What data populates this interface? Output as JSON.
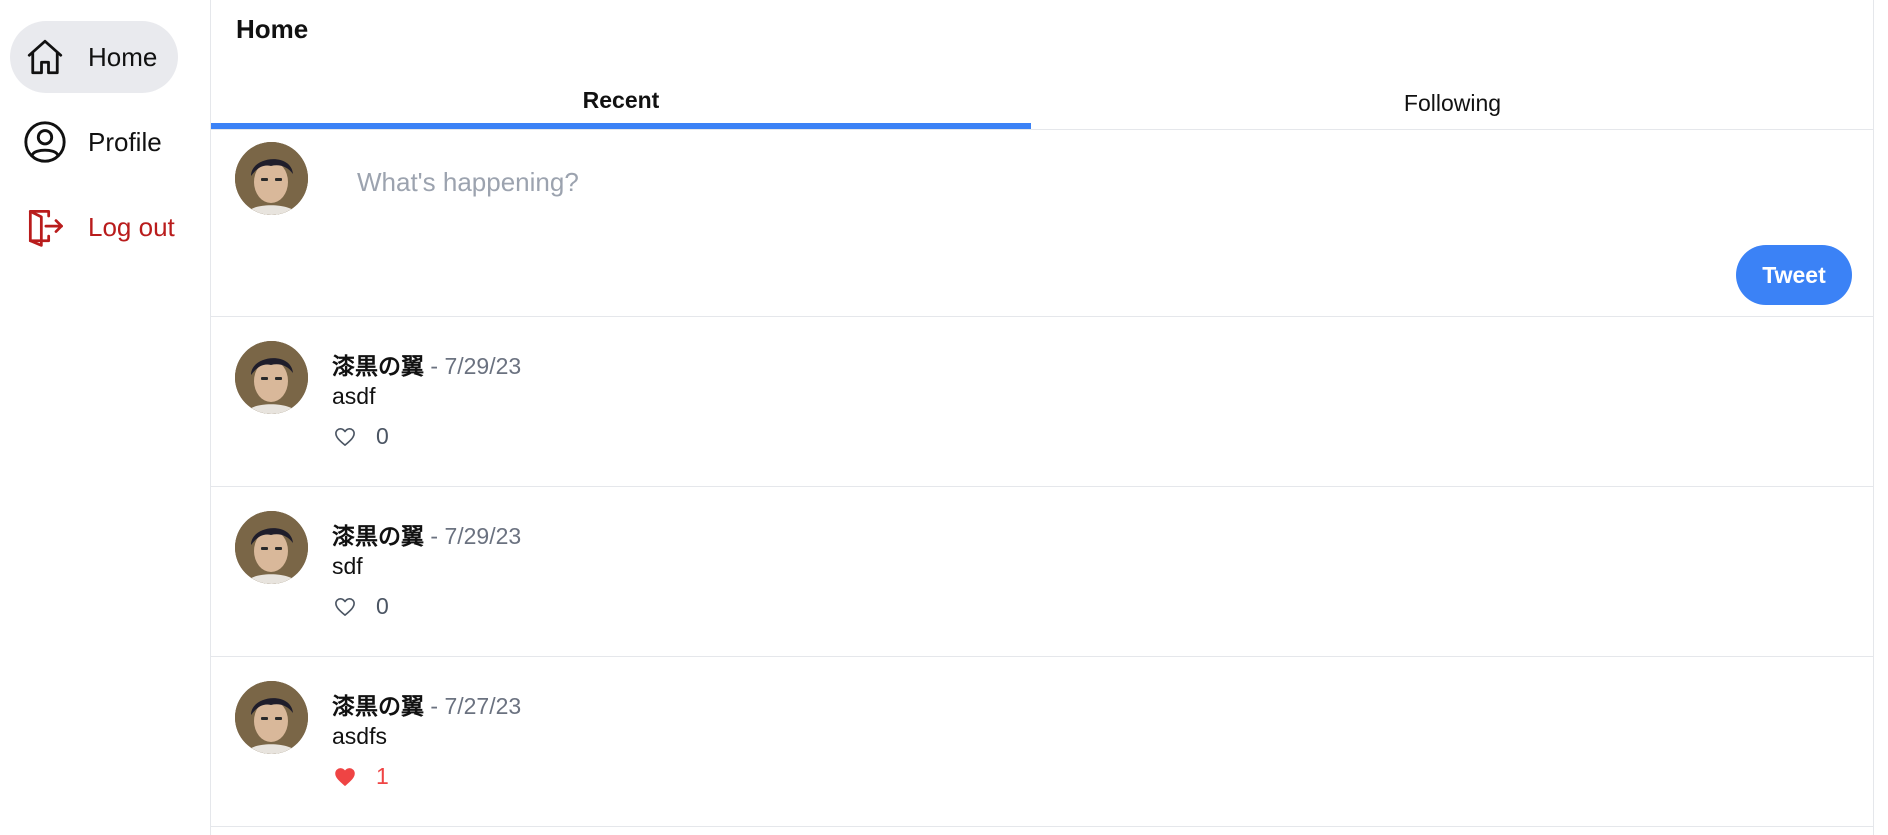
{
  "sidebar": {
    "items": [
      {
        "label": "Home",
        "icon": "home-icon"
      },
      {
        "label": "Profile",
        "icon": "user-circle-icon"
      },
      {
        "label": "Log out",
        "icon": "logout-icon",
        "color": "#b91c1c"
      }
    ]
  },
  "header": {
    "title": "Home"
  },
  "tabs": [
    {
      "label": "Recent",
      "active": true
    },
    {
      "label": "Following",
      "active": false
    }
  ],
  "composer": {
    "placeholder": "What's happening?",
    "button_label": "Tweet"
  },
  "posts": [
    {
      "author": "漆黒の翼",
      "separator": "-",
      "date": "7/29/23",
      "text": "asdf",
      "likes": "0",
      "liked": false
    },
    {
      "author": "漆黒の翼",
      "separator": "-",
      "date": "7/29/23",
      "text": "sdf",
      "likes": "0",
      "liked": false
    },
    {
      "author": "漆黒の翼",
      "separator": "-",
      "date": "7/27/23",
      "text": "asdfs",
      "likes": "1",
      "liked": true
    }
  ],
  "colors": {
    "accent": "#3b82f6",
    "danger": "#b91c1c",
    "like": "#ef4444",
    "muted": "#6b7280"
  }
}
